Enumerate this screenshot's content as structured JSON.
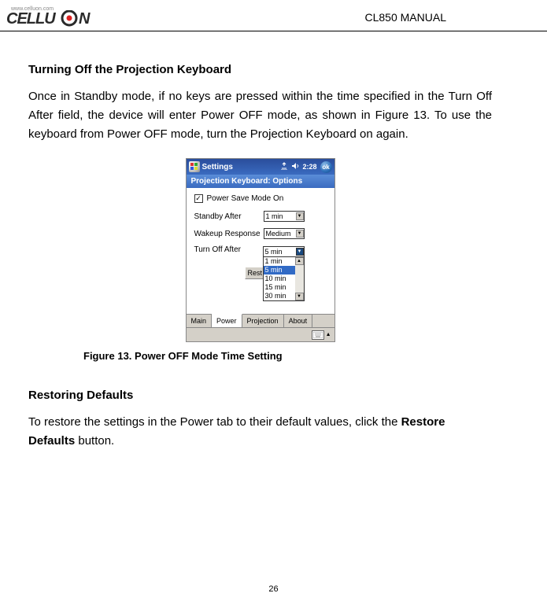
{
  "header": {
    "logo_url": "www.celluon.com",
    "doc_title": "CL850 MANUAL"
  },
  "section1": {
    "heading": "Turning Off the Projection Keyboard",
    "body": "Once in Standby mode, if no keys are pressed within the time specified in the Turn Off After field, the device will enter Power OFF mode, as shown in Figure 13. To use the keyboard from Power OFF mode, turn the Projection Keyboard on again."
  },
  "pda": {
    "title": "Settings",
    "time": "2:28",
    "ok": "ok",
    "subtitle": "Projection Keyboard: Options",
    "checkbox_label": "Power Save Mode On",
    "row1_label": "Standby After",
    "row1_value": "1 min",
    "row2_label": "Wakeup Response",
    "row2_value": "Medium",
    "row3_label": "Turn Off After",
    "row3_value": "5 min",
    "dropdown_items": [
      "1 min",
      "5 min",
      "10 min",
      "15 min",
      "30 min"
    ],
    "dropdown_selected_index": 1,
    "reset_peek": "Rest",
    "tabs": [
      "Main",
      "Power",
      "Projection",
      "About"
    ],
    "active_tab_index": 1
  },
  "figure_caption": "Figure 13. Power OFF Mode Time Setting",
  "section2": {
    "heading": "Restoring Defaults",
    "body_pre": "To restore the settings in the Power tab to their default values, click the ",
    "body_bold": "Restore Defaults",
    "body_post": " button."
  },
  "page_number": "26"
}
